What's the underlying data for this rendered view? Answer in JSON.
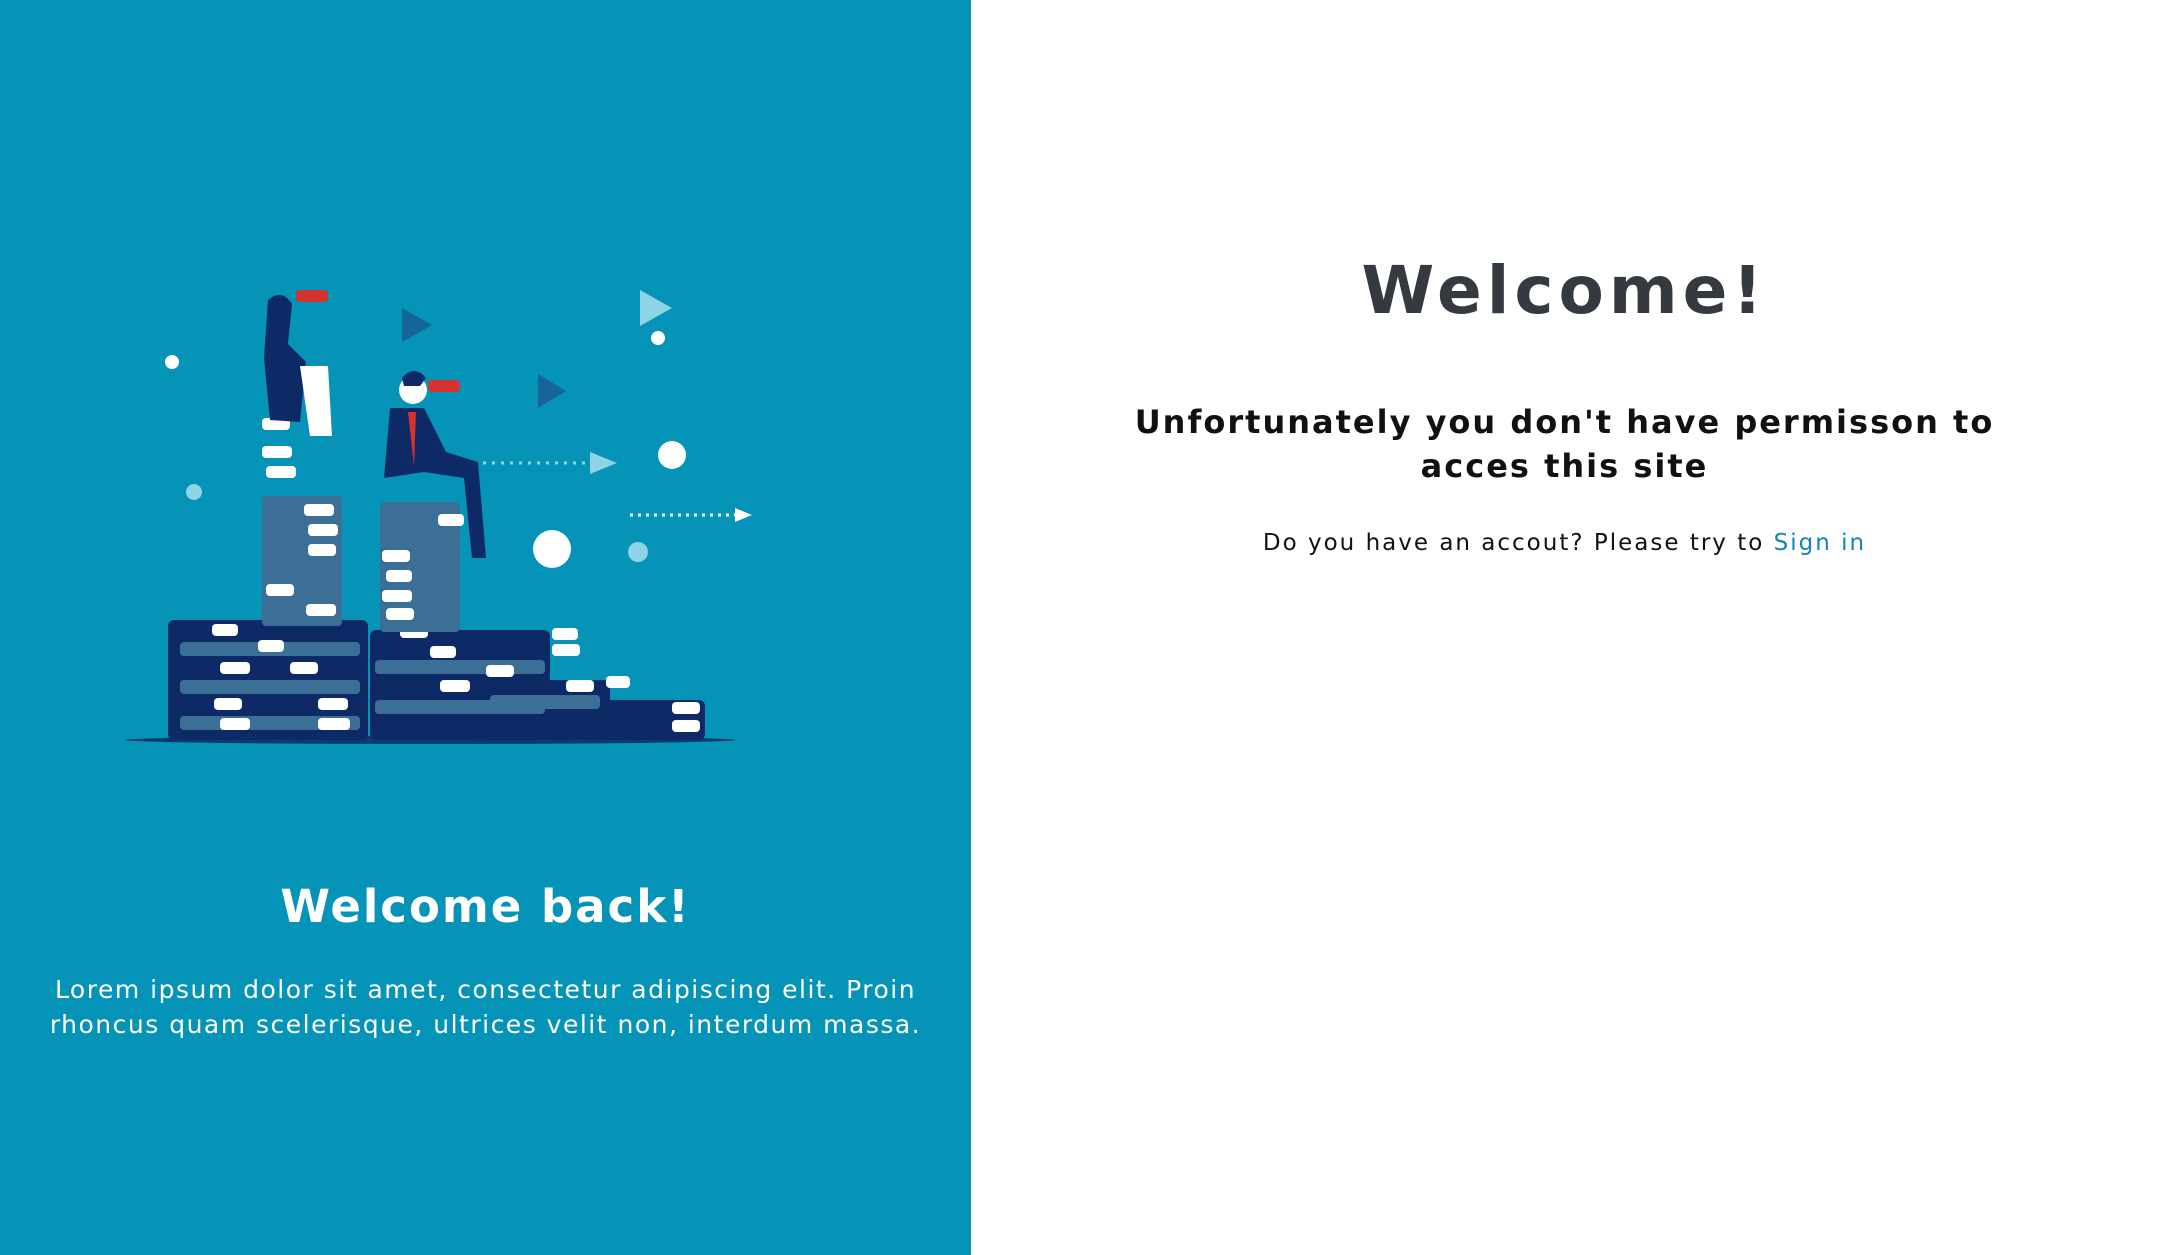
{
  "left": {
    "heading": "Welcome back!",
    "text": "Lorem ipsum dolor sit amet, consectetur adipiscing elit. Proin rhoncus quam scelerisque, ultrices velit non, interdum massa.",
    "illustration_icon": "business-explorers-on-books-illustration",
    "background_color": "#0594b8"
  },
  "right": {
    "title": "Welcome!",
    "subtitle": "Unfortunately you don't have permisson to acces this site",
    "prompt_text": "Do you have an accout? Please try to ",
    "link_label": "Sign in",
    "link_color": "#1683b5"
  }
}
